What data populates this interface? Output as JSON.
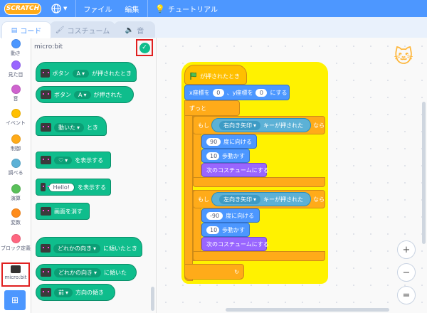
{
  "menubar": {
    "logo": "SCRATCH",
    "file": "ファイル",
    "edit": "編集",
    "tutorials": "チュートリアル"
  },
  "tabs": {
    "code": "コード",
    "costumes": "コスチューム",
    "sounds": "音"
  },
  "categories": [
    {
      "label": "動き",
      "color": "#4c97ff"
    },
    {
      "label": "見た目",
      "color": "#9966ff"
    },
    {
      "label": "音",
      "color": "#cf63cf"
    },
    {
      "label": "イベント",
      "color": "#ffbf00"
    },
    {
      "label": "制御",
      "color": "#ffab19"
    },
    {
      "label": "調べる",
      "color": "#5cb1d6"
    },
    {
      "label": "演算",
      "color": "#59c059"
    },
    {
      "label": "変数",
      "color": "#ff8c1a"
    },
    {
      "label": "ブロック定義",
      "color": "#ff6680"
    },
    {
      "label": "micro:bit",
      "color": "#0fbd8c"
    }
  ],
  "palette": {
    "title": "micro:bit",
    "b1_button": "ボタン",
    "b1_opt": "A",
    "b1_tail": "が押されたとき",
    "b2_button": "ボタン",
    "b2_opt": "A",
    "b2_tail": "が押された",
    "b3_opt": "動いた",
    "b3_tail": "とき",
    "b4_tail": "を表示する",
    "b5_text": "Hello!",
    "b5_tail": "を表示する",
    "b6_label": "画面を消す",
    "b7_opt": "どれかの向き",
    "b7_tail": "に傾いたとき",
    "b8_opt": "どれかの向き",
    "b8_tail": "に傾いた",
    "b9_opt": "前",
    "b9_tail": "方向の傾き"
  },
  "script": {
    "hat": "が押されたとき",
    "goto_x": "x座標を",
    "x_val": "0",
    "goto_y": "、y座標を",
    "y_val": "0",
    "goto_tail": "にする",
    "forever": "ずっと",
    "if1": "もし",
    "key1": "右向き矢印",
    "key_tail": "キーが押された",
    "then": "なら",
    "dir1": "90",
    "point": "度に向ける",
    "steps1": "10",
    "move": "歩動かす",
    "costume": "次のコスチュームにする",
    "if2": "もし",
    "key2": "左向き矢印",
    "dir2": "-90",
    "steps2": "10"
  },
  "zoom": {
    "in": "+",
    "out": "−",
    "reset": "="
  }
}
